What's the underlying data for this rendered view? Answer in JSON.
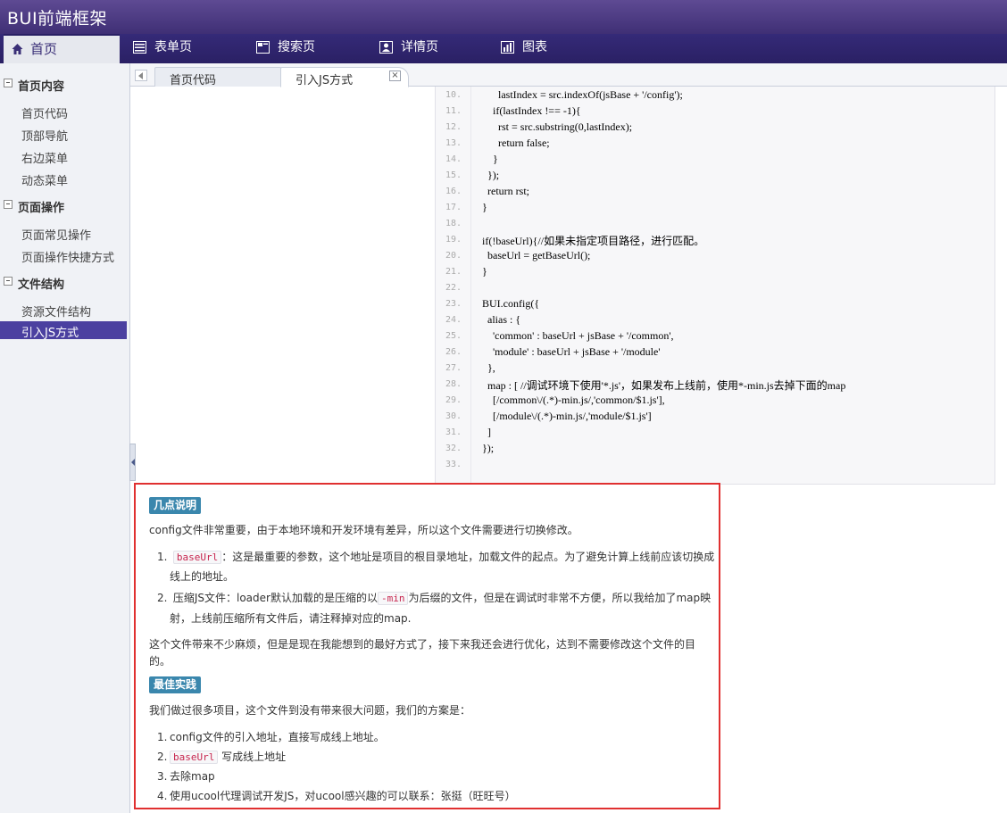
{
  "app": {
    "title": "BUI前端框架"
  },
  "top_nav": [
    {
      "label": "首页",
      "icon": "home-icon",
      "active": true
    },
    {
      "label": "表单页",
      "icon": "form-icon"
    },
    {
      "label": "搜索页",
      "icon": "search-page-icon"
    },
    {
      "label": "详情页",
      "icon": "user-card-icon"
    },
    {
      "label": "图表",
      "icon": "chart-icon"
    }
  ],
  "sidebar": {
    "groups": [
      {
        "label": "首页内容",
        "items": [
          "首页代码",
          "顶部导航",
          "右边菜单",
          "动态菜单"
        ]
      },
      {
        "label": "页面操作",
        "items": [
          "页面常见操作",
          "页面操作快捷方式"
        ]
      },
      {
        "label": "文件结构",
        "items": [
          "资源文件结构",
          "引入JS方式"
        ]
      }
    ],
    "active_item": "引入JS方式"
  },
  "tabs": [
    {
      "label": "首页代码",
      "active": false
    },
    {
      "label": "引入JS方式",
      "active": true,
      "close": "×"
    }
  ],
  "code": {
    "lines": [
      {
        "n": "10.",
        "text": "      lastIndex = src.indexOf(jsBase + '/config');"
      },
      {
        "n": "11.",
        "text": "    if(lastIndex !== -1){"
      },
      {
        "n": "12.",
        "text": "      rst = src.substring(0,lastIndex);"
      },
      {
        "n": "13.",
        "text": "      return false;"
      },
      {
        "n": "14.",
        "text": "    }"
      },
      {
        "n": "15.",
        "text": "  });"
      },
      {
        "n": "16.",
        "text": "  return rst;"
      },
      {
        "n": "17.",
        "text": "}"
      },
      {
        "n": "18.",
        "text": ""
      },
      {
        "n": "19.",
        "text": "if(!baseUrl){//如果未指定项目路径，进行匹配。"
      },
      {
        "n": "20.",
        "text": "  baseUrl = getBaseUrl();"
      },
      {
        "n": "21.",
        "text": "}"
      },
      {
        "n": "22.",
        "text": ""
      },
      {
        "n": "23.",
        "text": "BUI.config({"
      },
      {
        "n": "24.",
        "text": "  alias : {"
      },
      {
        "n": "25.",
        "text": "    'common' : baseUrl + jsBase + '/common',"
      },
      {
        "n": "26.",
        "text": "    'module' : baseUrl + jsBase + '/module'"
      },
      {
        "n": "27.",
        "text": "  },"
      },
      {
        "n": "28.",
        "text": "  map : [ //调试环境下使用'*.js'，如果发布上线前，使用*-min.js去掉下面的map"
      },
      {
        "n": "29.",
        "text": "    [/common\\/(.*)-min.js/,'common/$1.js'],"
      },
      {
        "n": "30.",
        "text": "    [/module\\/(.*)-min.js/,'module/$1.js']"
      },
      {
        "n": "31.",
        "text": "  ]"
      },
      {
        "n": "32.",
        "text": "});"
      },
      {
        "n": "33.",
        "text": ""
      }
    ]
  },
  "doc": {
    "section1_title": "几点说明",
    "intro": "config文件非常重要，由于本地环境和开发环境有差异，所以这个文件需要进行切换修改。",
    "item1_code": "baseUrl",
    "item1_text_a": "：这是最重要的参数，这个地址是项目的根目录地址，加载文件的起点。为了避免计算上线前应该切换成",
    "item1_text_b": "线上的地址。",
    "item2_text_a": "压缩JS文件：loader默认加载的是压缩的以",
    "item2_code": "-min",
    "item2_text_b": "为后缀的文件，但是在调试时非常不方便，所以我给加了map映",
    "item2_text_c": "射，上线前压缩所有文件后，请注释掉对应的map.",
    "note_a": "这个文件带来不少麻烦，但是是现在我能想到的最好方式了，接下来我还会进行优化，达到不需要修改这个文件的目",
    "note_b": "的。",
    "section2_title": "最佳实践",
    "section2_intro": "我们做过很多项目，这个文件到没有带来很大问题，我们的方案是：",
    "practice1": "config文件的引入地址，直接写成线上地址。",
    "practice2_code": "baseUrl",
    "practice2_text": " 写成线上地址",
    "practice3": "去除map",
    "practice4": "使用ucool代理调试开发JS，对ucool感兴趣的可以联系：张挺（旺旺号）",
    "num1": "1.",
    "num2": "2.",
    "num3": "3.",
    "num4": "4."
  }
}
